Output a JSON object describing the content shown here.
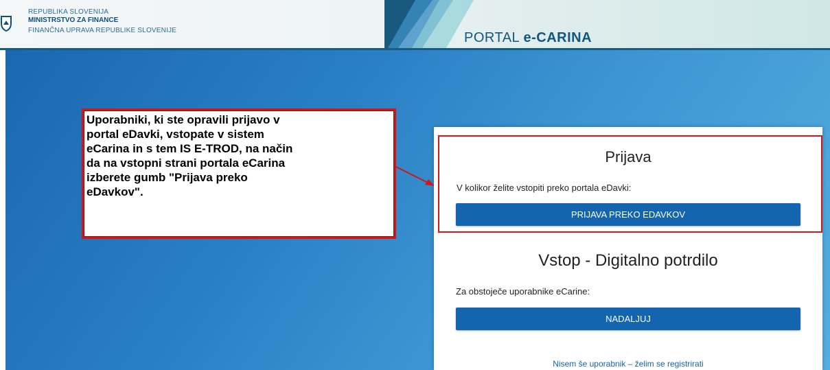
{
  "header": {
    "org_line1": "REPUBLIKA SLOVENIJA",
    "org_line2": "MINISTRSTVO ZA FINANCE",
    "org_line3": "FINANČNA UPRAVA REPUBLIKE SLOVENIJE",
    "portal_prefix": "PORTAL ",
    "portal_name": "e-CARINA"
  },
  "callout": {
    "text": "Uporabniki, ki ste opravili prijavo v\nportal eDavki, vstopate v sistem\neCarina in s tem IS E-TROD, na način\nda na vstopni strani portala eCarina\nizberete gumb \"Prijava preko\neDavkov\"."
  },
  "login": {
    "title": "Prijava",
    "edavki_label": "V kolikor želite vstopiti preko portala eDavki:",
    "edavki_button": "PRIJAVA PREKO EDAVKOV",
    "cert_title": "Vstop - Digitalno potrdilo",
    "cert_label": "Za obstoječe uporabnike eCarine:",
    "cert_button": "NADALJUJ",
    "register_link": "Nisem še uporabnik – želim se registrirati"
  },
  "colors": {
    "accent_blue": "#1365b0",
    "highlight_red": "#d11717"
  }
}
